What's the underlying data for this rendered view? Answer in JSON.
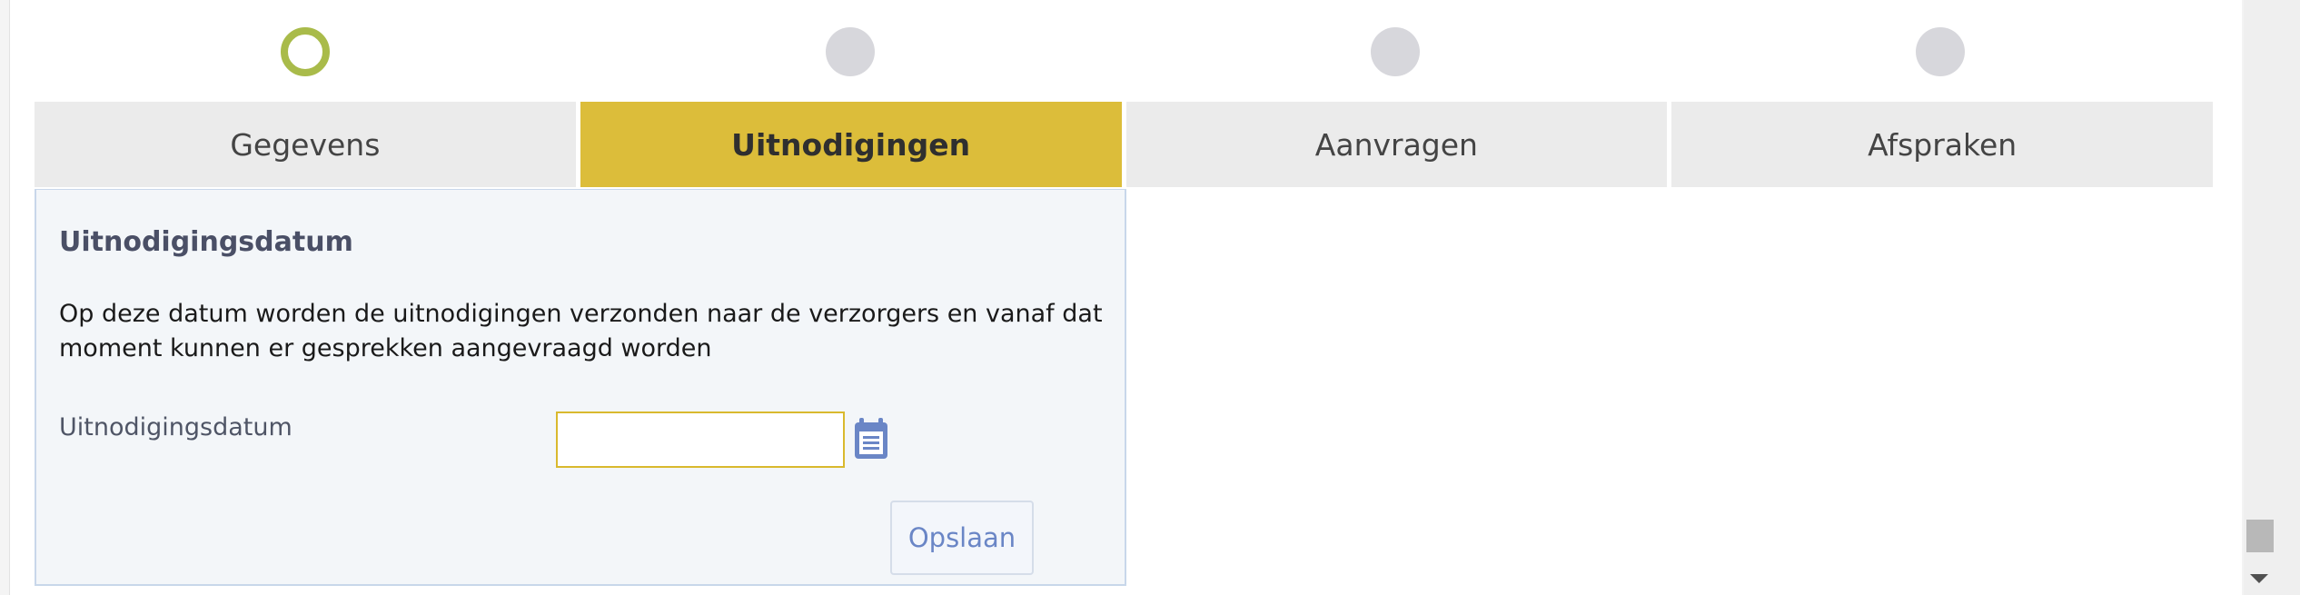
{
  "steps": [
    {
      "label": "Gegevens",
      "state": "current"
    },
    {
      "label": "Uitnodigingen",
      "state": "active"
    },
    {
      "label": "Aanvragen",
      "state": "pending"
    },
    {
      "label": "Afspraken",
      "state": "pending"
    }
  ],
  "panel": {
    "title": "Uitnodigingsdatum",
    "description": "Op deze datum worden de uitnodigingen verzonden naar de verzorgers en vanaf dat moment kunnen er gesprekken aangevraagd worden",
    "field_label": "Uitnodigingsdatum",
    "date_value": "",
    "date_placeholder": "",
    "calendar_icon": "calendar-icon",
    "save_label": "Opslaan"
  },
  "colors": {
    "accent_yellow": "#dcbd3a",
    "step_done_ring": "#a9bb4a",
    "step_pending": "#d7d7dc",
    "tab_bg": "#ebebeb",
    "panel_bg": "#f3f6f9",
    "panel_border": "#c8d7ea",
    "button_text": "#6a86c6",
    "icon_blue": "#6a86c6"
  }
}
